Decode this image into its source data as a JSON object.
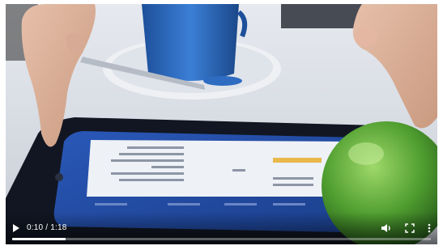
{
  "player": {
    "time": {
      "current": "0:10",
      "separator": " / ",
      "duration": "1:18"
    },
    "progress_fraction": 0.128,
    "icons": {
      "play": "play-icon",
      "volume": "volume-icon",
      "fullscreen": "fullscreen-icon",
      "more": "more-options-icon"
    },
    "colors": {
      "progress_fill": "#ffffff",
      "progress_track": "rgba(255,255,255,0.35)",
      "icon": "#ffffff"
    }
  }
}
